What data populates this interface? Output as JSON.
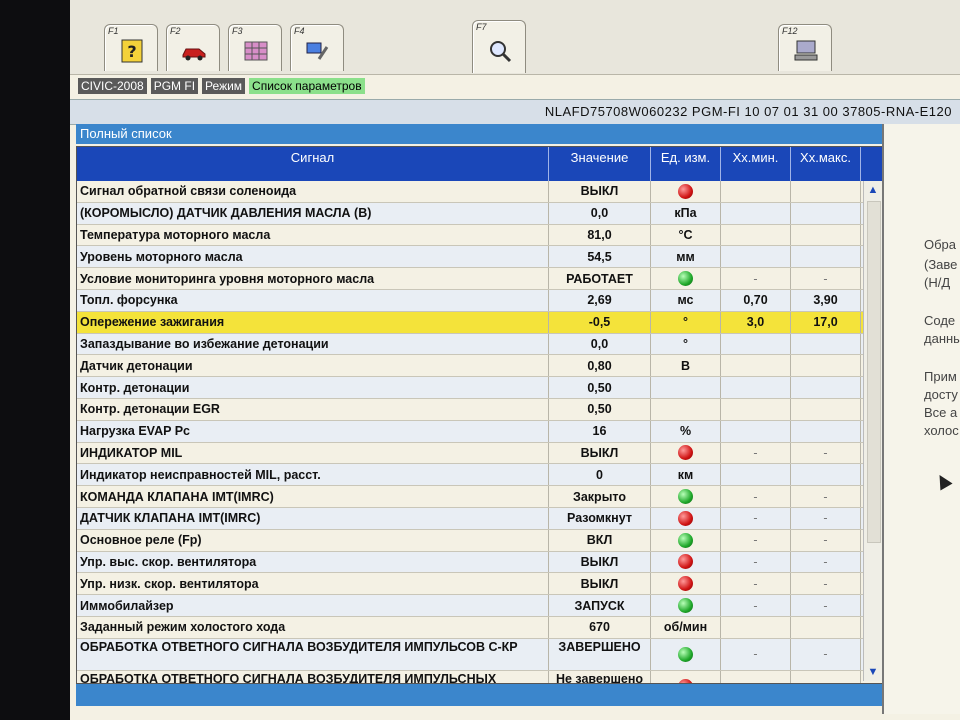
{
  "toolbar": {
    "keys": [
      {
        "label": "F1",
        "icon": "help-icon"
      },
      {
        "label": "F2",
        "icon": "car-icon"
      },
      {
        "label": "F3",
        "icon": "grid-icon"
      },
      {
        "label": "F4",
        "icon": "tool-icon"
      },
      {
        "label": "F7",
        "icon": "magnifier-icon"
      },
      {
        "label": "F12",
        "icon": "computer-icon"
      }
    ]
  },
  "breadcrumb": [
    "CIVIC-2008",
    "PGM FI",
    "Режим",
    "Список параметров"
  ],
  "vin_info": "NLAFD75708W060232  PGM-FI  10 07 01 31 00  37805-RNA-E120",
  "list_title": "Полный список",
  "columns": {
    "signal": "Сигнал",
    "value": "Значение",
    "unit": "Ед. изм.",
    "min": "Хх.мин.",
    "max": "Хх.макс."
  },
  "rows": [
    {
      "signal": "Сигнал обратной связи соленоида",
      "value": "ВЫКЛ",
      "unit": "",
      "dot": "red",
      "min": "",
      "max": ""
    },
    {
      "signal": "(КОРОМЫСЛО) ДАТЧИК ДАВЛЕНИЯ МАСЛА (В)",
      "value": "0,0",
      "unit": "кПа",
      "dot": "",
      "min": "",
      "max": ""
    },
    {
      "signal": "Температура моторного масла",
      "value": "81,0",
      "unit": "°C",
      "dot": "",
      "min": "",
      "max": ""
    },
    {
      "signal": "Уровень моторного масла",
      "value": "54,5",
      "unit": "мм",
      "dot": "",
      "min": "",
      "max": ""
    },
    {
      "signal": "Условие мониторинга уровня моторного масла",
      "value": "РАБОТАЕТ",
      "unit": "",
      "dot": "green",
      "min": "-",
      "max": "-"
    },
    {
      "signal": "Топл. форсунка",
      "value": "2,69",
      "unit": "мс",
      "dot": "",
      "min": "0,70",
      "max": "3,90"
    },
    {
      "signal": "Опережение зажигания",
      "value": "-0,5",
      "unit": "°",
      "dot": "",
      "min": "3,0",
      "max": "17,0",
      "highlight": true
    },
    {
      "signal": "Запаздывание во избежание детонации",
      "value": "0,0",
      "unit": "°",
      "dot": "",
      "min": "",
      "max": ""
    },
    {
      "signal": "Датчик детонации",
      "value": "0,80",
      "unit": "В",
      "dot": "",
      "min": "",
      "max": ""
    },
    {
      "signal": "Контр. детонации",
      "value": "0,50",
      "unit": "",
      "dot": "",
      "min": "",
      "max": ""
    },
    {
      "signal": "Контр. детонации EGR",
      "value": "0,50",
      "unit": "",
      "dot": "",
      "min": "",
      "max": ""
    },
    {
      "signal": "Нагрузка EVAP Pc",
      "value": "16",
      "unit": "%",
      "dot": "",
      "min": "",
      "max": ""
    },
    {
      "signal": "ИНДИКАТОР MIL",
      "value": "ВЫКЛ",
      "unit": "",
      "dot": "red",
      "min": "-",
      "max": "-"
    },
    {
      "signal": "Индикатор неисправностей MIL, расст.",
      "value": "0",
      "unit": "км",
      "dot": "",
      "min": "",
      "max": ""
    },
    {
      "signal": "КОМАНДА КЛАПАНА IMT(IMRC)",
      "value": "Закрыто",
      "unit": "",
      "dot": "green",
      "min": "-",
      "max": "-"
    },
    {
      "signal": "ДАТЧИК КЛАПАНА IMT(IMRC)",
      "value": "Разомкнут",
      "unit": "",
      "dot": "red",
      "min": "-",
      "max": "-"
    },
    {
      "signal": "Основное реле (Fp)",
      "value": "ВКЛ",
      "unit": "",
      "dot": "green",
      "min": "-",
      "max": "-"
    },
    {
      "signal": "Упр. выс. скор. вентилятора",
      "value": "ВЫКЛ",
      "unit": "",
      "dot": "red",
      "min": "-",
      "max": "-"
    },
    {
      "signal": "Упр. низк. скор. вентилятора",
      "value": "ВЫКЛ",
      "unit": "",
      "dot": "red",
      "min": "-",
      "max": "-"
    },
    {
      "signal": "Иммобилайзер",
      "value": "ЗАПУСК",
      "unit": "",
      "dot": "green",
      "min": "-",
      "max": "-"
    },
    {
      "signal": "Заданный режим холостого хода",
      "value": "670",
      "unit": "об/мин",
      "dot": "",
      "min": "",
      "max": ""
    },
    {
      "signal": "ОБРАБОТКА ОТВЕТНОГО СИГНАЛА ВОЗБУДИТЕЛЯ ИМПУЛЬСОВ С-КР",
      "value": "ЗАВЕРШЕНО",
      "unit": "",
      "dot": "green",
      "min": "-",
      "max": "-",
      "tall": true
    },
    {
      "signal": "ОБРАБОТКА ОТВЕТНОГО СИГНАЛА ВОЗБУДИТЕЛЯ ИМПУЛЬСНЫХ СИГНАЛОВ СКР (ВЫСОКИЕ ОБОРОТЫ)",
      "value": "Не завершено",
      "unit": "",
      "dot": "red",
      "min": "-",
      "max": "-",
      "tall": true
    }
  ],
  "right_panel": [
    "Обра",
    "(Заве",
    "(Н/Д",
    "",
    "Соде",
    "данны",
    "",
    "Прим",
    "досту",
    "Все а",
    "холос"
  ],
  "colors": {
    "header": "#1a47b8",
    "title_bar": "#3b86cc",
    "highlight": "#f4e33a",
    "crumb_active": "#8be08b"
  }
}
